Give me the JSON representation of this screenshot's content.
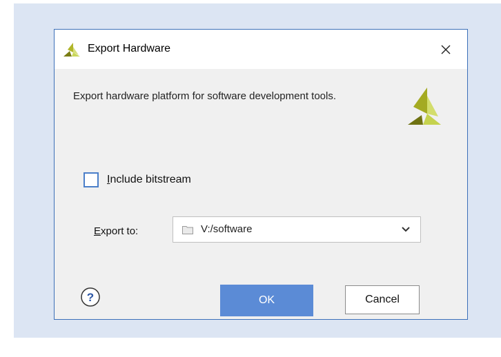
{
  "dialog": {
    "title": "Export Hardware",
    "description": "Export hardware platform for software development tools.",
    "include_bitstream": {
      "label_mnemonic": "I",
      "label_rest": "nclude bitstream",
      "checked": false
    },
    "export_to": {
      "label_mnemonic": "E",
      "label_rest": "xport to:",
      "value": "V:/software"
    },
    "buttons": {
      "ok": "OK",
      "cancel": "Cancel"
    }
  },
  "icons": {
    "title_logo": "xilinx-logo-icon",
    "close": "close-icon",
    "brand_logo": "xilinx-logo-icon",
    "folder": "folder-icon",
    "dropdown": "chevron-down-icon",
    "help": "help-icon"
  },
  "colors": {
    "backdrop": "#dce5f3",
    "dialog_border": "#3b6fb8",
    "accent": "#5b8bd6",
    "checkbox_border": "#4a7ec9",
    "logo_dark": "#7a7d14",
    "logo_light": "#c9d65a"
  }
}
